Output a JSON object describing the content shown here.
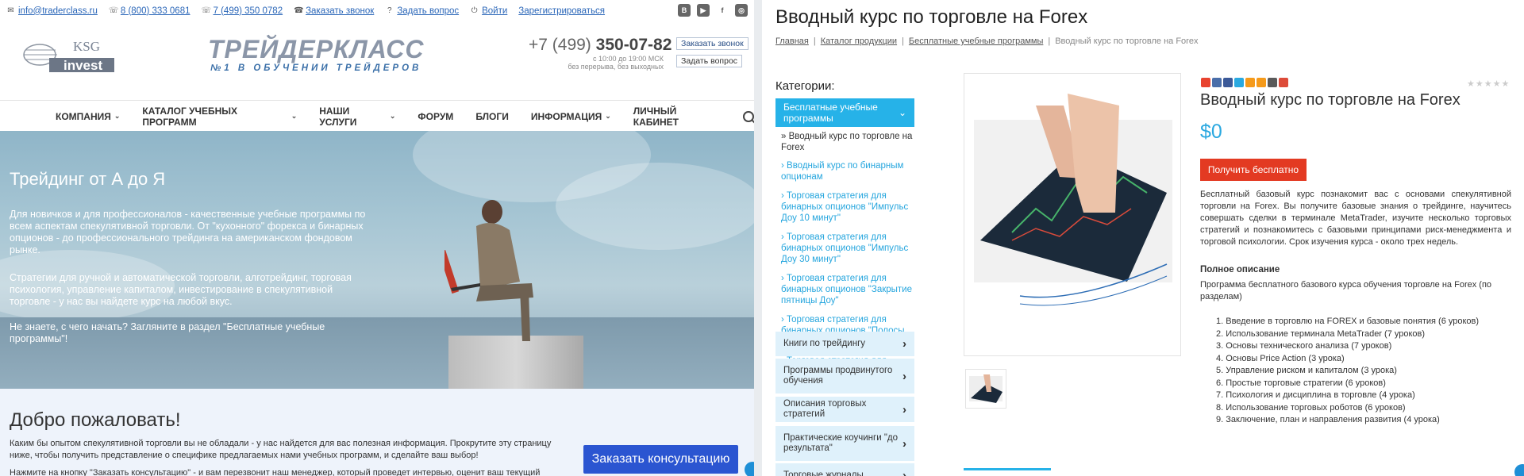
{
  "topbar": {
    "email": "info@traderclass.ru",
    "phone1": "8 (800) 333 0681",
    "phone2": "7 (499) 350 0782",
    "callback": "Заказать звонок",
    "ask": "Задать вопрос",
    "login": "Войти",
    "register": "Зарегистрироваться",
    "social": [
      "В",
      "▶",
      "f",
      "◎"
    ]
  },
  "header": {
    "ksg_top": "KSG",
    "ksg_bottom": "invest",
    "brand_name": "ТРЕЙДЕРКЛАСС",
    "brand_tag": "№1 В ОБУЧЕНИИ ТРЕЙДЕРОВ",
    "phone_prefix": "+7 (499)",
    "phone_main": "350-07-82",
    "hours1": "с 10:00 до 19:00 МСК",
    "hours2": "без перерыва, без выходных",
    "btn_callback": "Заказать звонок",
    "btn_ask": "Задать вопрос"
  },
  "nav": {
    "items": [
      {
        "label": "КОМПАНИЯ",
        "chev": "⌄"
      },
      {
        "label": "КАТАЛОГ УЧЕБНЫХ ПРОГРАММ",
        "chev": "⌄"
      },
      {
        "label": "НАШИ УСЛУГИ",
        "chev": "⌄"
      },
      {
        "label": "ФОРУМ",
        "chev": ""
      },
      {
        "label": "БЛОГИ",
        "chev": ""
      },
      {
        "label": "ИНФОРМАЦИЯ",
        "chev": "⌄"
      },
      {
        "label": "ЛИЧНЫЙ КАБИНЕТ",
        "chev": ""
      }
    ]
  },
  "hero": {
    "title": "Трейдинг от А до Я",
    "p1": "Для новичков и для профессионалов - качественные учебные программы по всем аспектам спекулятивной торговли. От \"кухонного\" форекса и бинарных опционов - до профессионального трейдинга на американском фондовом рынке.",
    "p2": "Стратегии для ручной и автоматической торговли, алготрейдинг, торговая психология, управление капиталом, инвестирование в спекулятивной торговле - у нас вы найдете курс на любой вкус.",
    "p3": "Не знаете, с чего начать? Загляните в раздел \"Бесплатные учебные программы\"!"
  },
  "welcome": {
    "title": "Добро пожаловать!",
    "text1": "Каким бы опытом спекулятивной торговли вы не обладали - у нас найдется для вас полезная информация. Прокрутите эту страницу ниже, чтобы получить представление о специфике предлагаемых нами учебных программ, и сделайте ваш выбор!",
    "text2": "Нажмите на кнопку \"Заказать консультацию\" - и вам перезвонит наш менеджер, который проведет интервью, оценит ваш текущий",
    "cta": "Заказать консультацию"
  },
  "product": {
    "page_title": "Вводный курс по торговле на Forex",
    "breadcrumbs": [
      "Главная",
      "Каталог продукции",
      "Бесплатные учебные программы"
    ],
    "breadcrumb_current": "Вводный курс по торговле на Forex",
    "categories_heading": "Категории:",
    "active_category": "Бесплатные учебные программы",
    "current_item": "» Вводный курс по торговле на Forex",
    "sub_items": [
      "› Вводный курс по бинарным опционам",
      "› Торговая стратегия для бинарных опционов \"Импульс Доу 10 минут\"",
      "› Торговая стратегия для бинарных опционов \"Импульс Доу 30 минут\"",
      "› Торговая стратегия для бинарных опционов \"Закрытие пятницы Доу\"",
      "› Торговая стратегия для бинарных опционов \"Полосы Боллинджера\"",
      "› Торговая стратегия для бинарных опционов \"Длинные скользящие\""
    ],
    "categories": [
      "Книги по трейдингу",
      "Программы продвинутого обучения",
      "Описания торговых стратегий",
      "Практические коучинги \"до результата\"",
      "Торговые журналы"
    ],
    "title": "Вводный курс по торговле на Forex",
    "price": "$0",
    "buy_button": "Получить бесплатно",
    "description": "Бесплатный базовый курс познакомит вас с основами спекулятивной торговли на Forex. Вы получите базовые знания о трейдинге, научитесь совершать сделки в терминале MetaTrader, изучите несколько торговых стратегий и познакомитесь с базовыми принципами риск-менеджмента и торговой психологии. Срок изучения курса - около трех недель.",
    "full_heading": "Полное описание",
    "full_text": "Программа бесплатного базового курса обучения торговле на Forex (по разделам)",
    "toc": [
      "1. Введение в торговлю на FOREX и базовые понятия (6 уроков)",
      "2. Использование терминала MetaTrader (7 уроков)",
      "3. Основы технического анализа (7 уроков)",
      "4. Основы Price Action (3 урока)",
      "5. Управление риском и капиталом (3 урока)",
      "6. Простые торговые стратегии (6 уроков)",
      "7. Психология и дисциплина в торговле (4 урока)",
      "8. Использование торговых роботов (6 уроков)",
      "9. Заключение, план и направления развития (4 урока)"
    ],
    "stars": "★★★★★",
    "share_colors": [
      "#e8432f",
      "#4a6ea9",
      "#3b5998",
      "#2aa9e0",
      "#f59a1a",
      "#f59a1a",
      "#5a5a5a",
      "#dd4b39"
    ]
  },
  "colors": {
    "accent": "#26b2e8",
    "buy": "#e33a22",
    "cta": "#2b55d1",
    "link": "#2a66b8"
  }
}
